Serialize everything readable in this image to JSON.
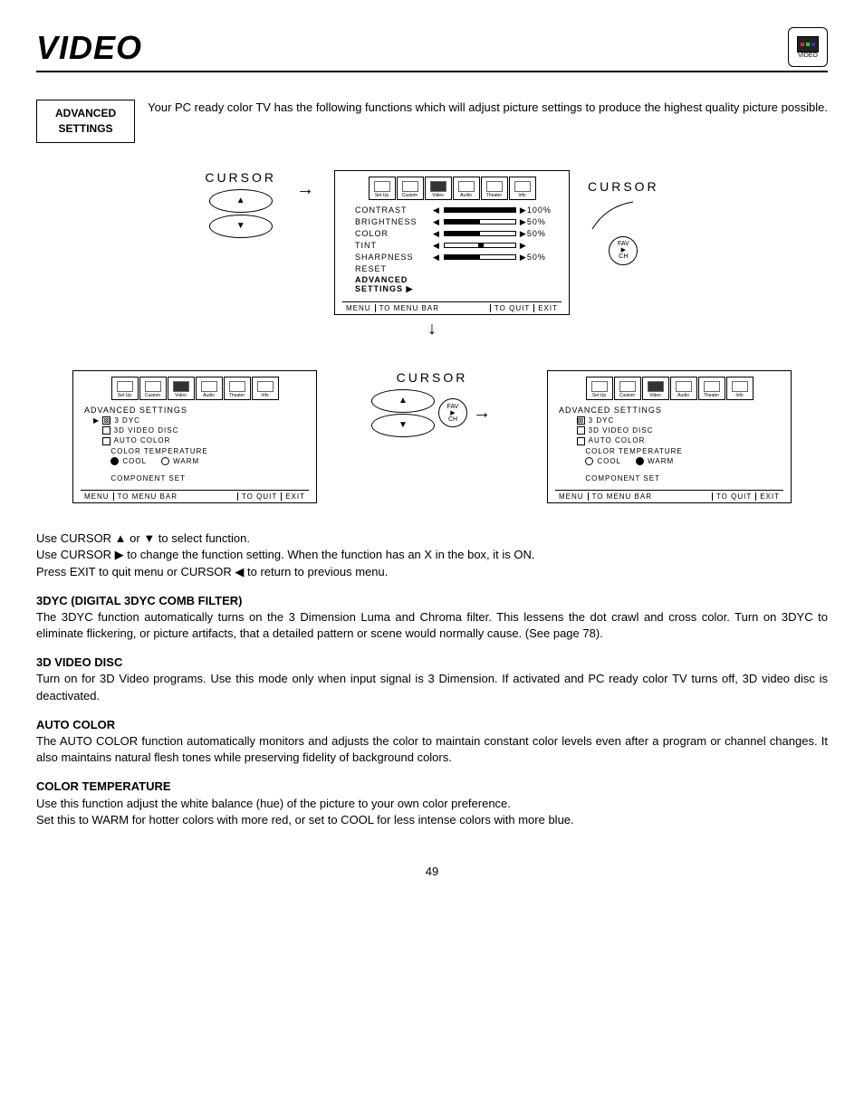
{
  "header": {
    "title": "VIDEO",
    "badge": "VIDEO"
  },
  "intro": {
    "box_l1": "ADVANCED",
    "box_l2": "SETTINGS",
    "text": "Your PC ready color TV has the following functions which will adjust picture settings to produce the highest quality picture possible."
  },
  "tabs": [
    "Set Up",
    "Custom",
    "Video",
    "Audio",
    "Theater",
    "Info"
  ],
  "cursor_label": "CURSOR",
  "fav": {
    "l1": "FAV",
    "l2": "▶",
    "l3": "CH"
  },
  "video_menu": {
    "rows": [
      {
        "name": "CONTRAST",
        "val": "100%",
        "fill": 100
      },
      {
        "name": "BRIGHTNESS",
        "val": "50%",
        "fill": 50
      },
      {
        "name": "COLOR",
        "val": "50%",
        "fill": 50
      },
      {
        "name": "TINT",
        "val": "",
        "fill": 50,
        "center": true
      },
      {
        "name": "SHARPNESS",
        "val": "50%",
        "fill": 50
      },
      {
        "name": "RESET",
        "val": "",
        "nobar": true
      }
    ],
    "adv1": "ADVANCED",
    "adv2": "SETTINGS ▶"
  },
  "foot": {
    "a": "MENU",
    "b": "TO MENU BAR",
    "c": "TO QUIT",
    "d": "EXIT"
  },
  "adv_menu": {
    "title": "ADVANCED SETTINGS",
    "dyc": "3 DYC",
    "disc": "3D VIDEO DISC",
    "auto": "AUTO COLOR",
    "temp": "COLOR TEMPERATURE",
    "cool": "COOL",
    "warm": "WARM",
    "comp": "COMPONENT SET"
  },
  "instr": {
    "p1": "Use CURSOR ▲ or ▼ to select function.",
    "p2": "Use CURSOR ▶ to change the function setting. When the function has an  X  in the box, it is ON.",
    "p3": "Press EXIT to quit menu or CURSOR ◀ to return to previous menu."
  },
  "sections": {
    "s1h": "3DYC (DIGITAL 3DYC COMB FILTER)",
    "s1": "The 3DYC function automatically turns on the 3 Dimension Luma and Chroma filter. This lessens the dot crawl and cross color. Turn on 3DYC to eliminate flickering, or picture artifacts, that a detailed pattern or scene would normally cause. (See page 78).",
    "s2h": "3D VIDEO DISC",
    "s2": "Turn on for 3D Video programs. Use this mode only when input signal is 3 Dimension. If activated and PC ready color TV turns off, 3D video disc is deactivated.",
    "s3h": "AUTO COLOR",
    "s3": "The AUTO COLOR function automatically monitors and adjusts the color to maintain constant color levels even after a program or channel changes. It also maintains natural flesh tones while preserving fidelity of background colors.",
    "s4h": "COLOR TEMPERATURE",
    "s4a": "Use this function adjust the white balance (hue) of the picture to your own color preference.",
    "s4b": "Set this to WARM for hotter colors with more red, or set to COOL for less intense colors with more blue."
  },
  "page": "49"
}
